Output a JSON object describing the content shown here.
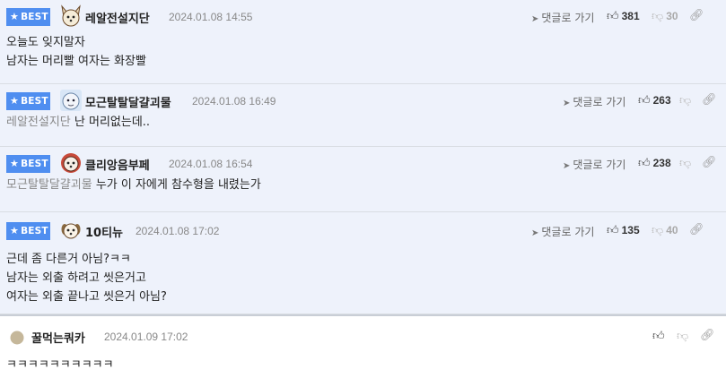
{
  "ui": {
    "best_label": "BEST",
    "reply_label": "댓글로 가기"
  },
  "comments": [
    {
      "best": true,
      "author": "레알전설지단",
      "date": "2024.01.08 14:55",
      "likes": "381",
      "dislikes": "30",
      "mention": "",
      "lines": [
        "오늘도 잊지말자",
        "남자는 머리빨 여자는 화장빨"
      ]
    },
    {
      "best": true,
      "author": "모근탈탈달걀괴물",
      "date": "2024.01.08 16:49",
      "likes": "263",
      "dislikes": "",
      "mention": "레알전설지단",
      "lines": [
        "난 머리없는데.."
      ]
    },
    {
      "best": true,
      "author": "클리앙음부페",
      "date": "2024.01.08 16:54",
      "likes": "238",
      "dislikes": "",
      "mention": "모근탈탈달걀괴물",
      "lines": [
        "누가 이 자에게 참수형을 내렸는가"
      ]
    },
    {
      "best": true,
      "author": "10티뉴",
      "date": "2024.01.08 17:02",
      "likes": "135",
      "dislikes": "40",
      "mention": "",
      "lines": [
        "근데 좀 다른거 아님?ㅋㅋ",
        "남자는 외출 하려고 씻은거고",
        "여자는 외출 끝나고 씻은거 아님?"
      ]
    },
    {
      "best": false,
      "author": "꿀먹는쿼카",
      "date": "2024.01.09 17:02",
      "likes": "",
      "dislikes": "",
      "mention": "",
      "lines": [
        "ㅋㅋㅋㅋㅋㅋㅋㅋㅋㅋ"
      ]
    }
  ],
  "colors": {
    "best_badge": "#4f8ef0",
    "best_background": "#eef2fb",
    "mention_text": "#888888"
  },
  "icons": [
    "star-icon",
    "reply-arrow-icon",
    "thumbs-up-icon",
    "thumbs-down-icon",
    "link-icon",
    "avatar"
  ]
}
